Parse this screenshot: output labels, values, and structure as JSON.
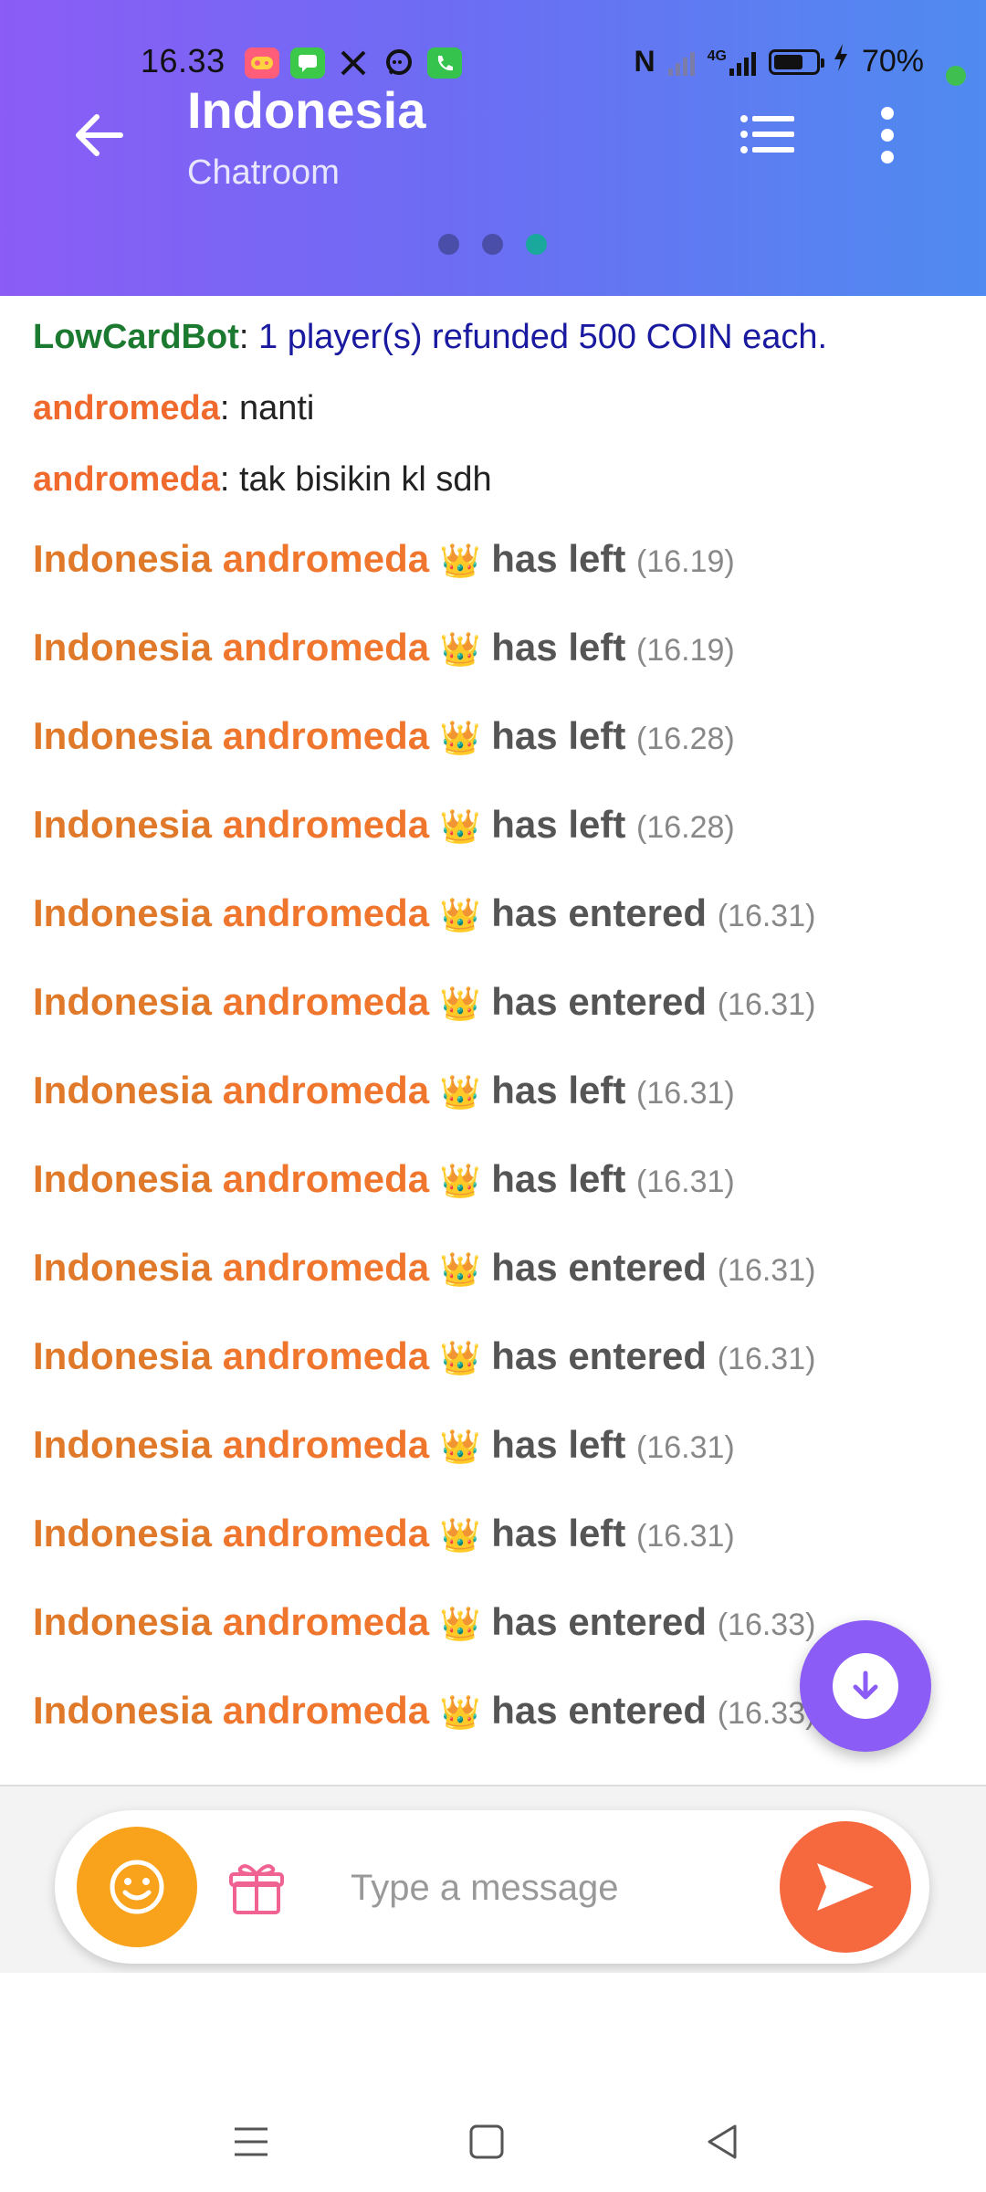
{
  "status_bar": {
    "time": "16.33",
    "network_label": "4G",
    "battery_percent": "70%",
    "battery_level": 0.7,
    "notification_icons": [
      "game-icon",
      "message-icon",
      "x-icon",
      "chat-icon",
      "phone-icon"
    ]
  },
  "header": {
    "title": "Indonesia",
    "subtitle": "Chatroom",
    "page_dots": 3,
    "active_dot": 2
  },
  "messages": [
    {
      "name": "LowCardBot",
      "sep": ": ",
      "text": "1 player(s) refunded 500 COIN each."
    },
    {
      "name": "andromeda",
      "sep": ": ",
      "text": "nanti"
    },
    {
      "name": "andromeda",
      "sep": ": ",
      "text": "tak bisikin kl sdh"
    }
  ],
  "events": [
    {
      "room": "Indonesia",
      "user": "andromeda",
      "crown": "👑",
      "action": "has left",
      "time": "(16.19)"
    },
    {
      "room": "Indonesia",
      "user": "andromeda",
      "crown": "👑",
      "action": "has left",
      "time": "(16.19)"
    },
    {
      "room": "Indonesia",
      "user": "andromeda",
      "crown": "👑",
      "action": "has left",
      "time": "(16.28)"
    },
    {
      "room": "Indonesia",
      "user": "andromeda",
      "crown": "👑",
      "action": "has left",
      "time": "(16.28)"
    },
    {
      "room": "Indonesia",
      "user": "andromeda",
      "crown": "👑",
      "action": "has entered",
      "time": "(16.31)"
    },
    {
      "room": "Indonesia",
      "user": "andromeda",
      "crown": "👑",
      "action": "has entered",
      "time": "(16.31)"
    },
    {
      "room": "Indonesia",
      "user": "andromeda",
      "crown": "👑",
      "action": "has left",
      "time": "(16.31)"
    },
    {
      "room": "Indonesia",
      "user": "andromeda",
      "crown": "👑",
      "action": "has left",
      "time": "(16.31)"
    },
    {
      "room": "Indonesia",
      "user": "andromeda",
      "crown": "👑",
      "action": "has entered",
      "time": "(16.31)"
    },
    {
      "room": "Indonesia",
      "user": "andromeda",
      "crown": "👑",
      "action": "has entered",
      "time": "(16.31)"
    },
    {
      "room": "Indonesia",
      "user": "andromeda",
      "crown": "👑",
      "action": "has left",
      "time": "(16.31)"
    },
    {
      "room": "Indonesia",
      "user": "andromeda",
      "crown": "👑",
      "action": "has left",
      "time": "(16.31)"
    },
    {
      "room": "Indonesia",
      "user": "andromeda",
      "crown": "👑",
      "action": "has entered",
      "time": "(16.33)"
    },
    {
      "room": "Indonesia",
      "user": "andromeda",
      "crown": "👑",
      "action": "has entered",
      "time": "(16.33)"
    }
  ],
  "composer": {
    "placeholder": "Type a message",
    "value": ""
  },
  "colors": {
    "header_gradient_start": "#8b5cf6",
    "header_gradient_end": "#4f8bf0",
    "bot_name": "#1c7a30",
    "bot_text": "#1a1aa0",
    "user_name": "#f06a2e",
    "emoji_button": "#f9a21b",
    "send_button": "#f6683e",
    "scroll_button": "#8b5cf6"
  }
}
